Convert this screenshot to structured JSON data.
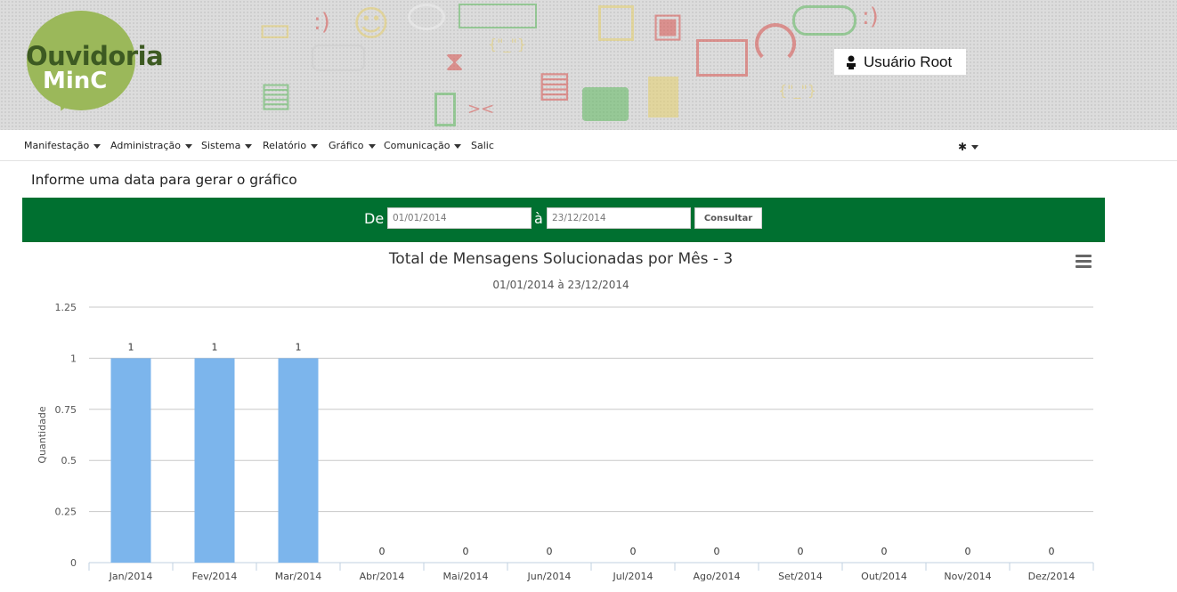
{
  "header": {
    "logo_line1": "Ouvidoria",
    "logo_line2": "MinC",
    "user_name": "Usuário Root"
  },
  "menu": {
    "items": [
      {
        "label": "Manifestação",
        "has_dropdown": true
      },
      {
        "label": "Administração",
        "has_dropdown": true
      },
      {
        "label": "Sistema",
        "has_dropdown": true
      },
      {
        "label": "Relatório",
        "has_dropdown": true
      },
      {
        "label": "Gráfico",
        "has_dropdown": true
      },
      {
        "label": "Comunicação",
        "has_dropdown": true
      },
      {
        "label": "Salic",
        "has_dropdown": false
      }
    ],
    "settings_icon": "gear-icon"
  },
  "form": {
    "title": "Informe uma data para gerar o gráfico",
    "from_label": "De",
    "from_value": "01/01/2014",
    "to_label": "à",
    "to_value": "23/12/2014",
    "submit_label": "Consultar"
  },
  "colors": {
    "filter_bar": "#007030",
    "bar": "#7cb5ec",
    "logo_green": "#9bb85a"
  },
  "chart_data": {
    "type": "bar",
    "title": "Total de Mensagens Solucionadas por Mês - 3",
    "subtitle": "01/01/2014 à 23/12/2014",
    "xlabel": "",
    "ylabel": "Quantidade",
    "categories": [
      "Jan/2014",
      "Fev/2014",
      "Mar/2014",
      "Abr/2014",
      "Mai/2014",
      "Jun/2014",
      "Jul/2014",
      "Ago/2014",
      "Set/2014",
      "Out/2014",
      "Nov/2014",
      "Dez/2014"
    ],
    "values": [
      1,
      1,
      1,
      0,
      0,
      0,
      0,
      0,
      0,
      0,
      0,
      0
    ],
    "data_labels": [
      "1",
      "1",
      "1",
      "0",
      "0",
      "0",
      "0",
      "0",
      "0",
      "0",
      "0",
      "0"
    ],
    "ylim": [
      0,
      1.25
    ],
    "yticks": [
      "0",
      "0.25",
      "0.5",
      "0.75",
      "1",
      "1.25"
    ],
    "grid": true,
    "legend": "none"
  }
}
